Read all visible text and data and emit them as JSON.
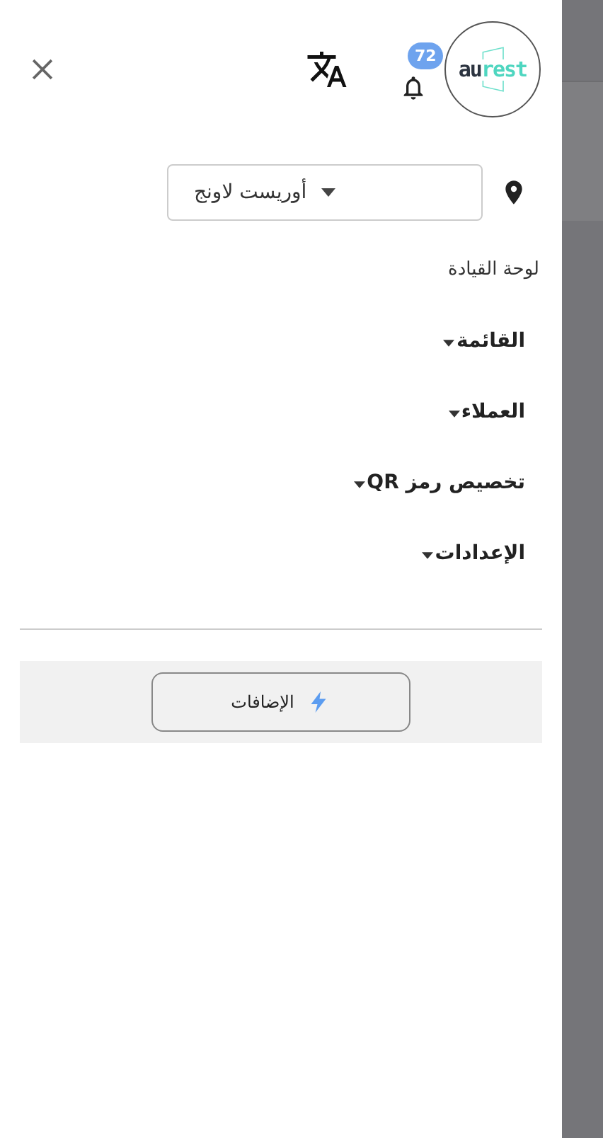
{
  "header": {
    "logo": {
      "part_1": "au",
      "part_2": "rest"
    },
    "notifications": {
      "count": "72"
    }
  },
  "branch_selector": {
    "value": "أوريست لاونج"
  },
  "menu": [
    {
      "label": "لوحة القيادة",
      "has_submenu": false
    },
    {
      "label": "القائمة",
      "has_submenu": true
    },
    {
      "label": "العملاء",
      "has_submenu": true
    },
    {
      "label": "تخصيص رمز QR",
      "has_submenu": true
    },
    {
      "label": "الإعدادات",
      "has_submenu": true
    }
  ],
  "addons_button": {
    "label": "الإضافات"
  }
}
